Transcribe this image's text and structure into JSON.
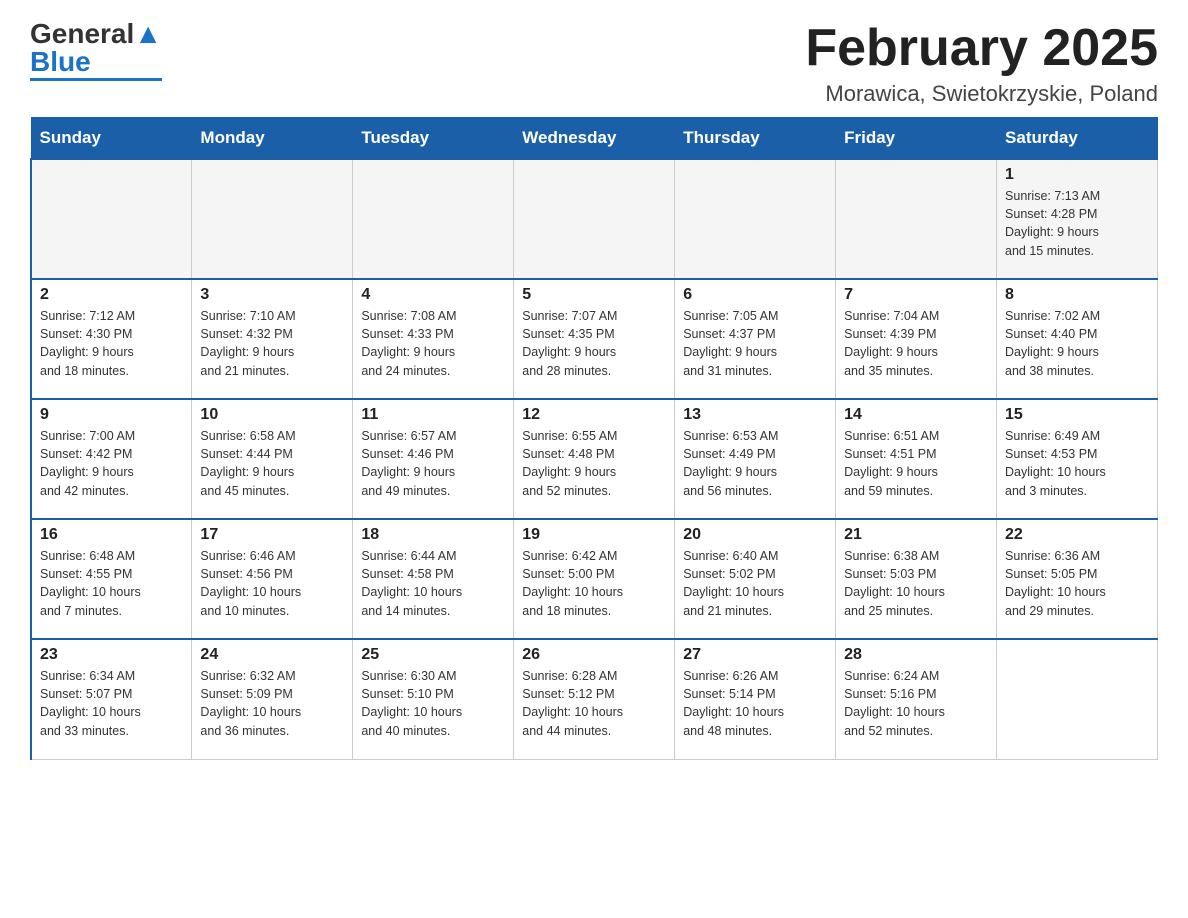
{
  "header": {
    "logo_main": "General",
    "logo_accent": "Blue",
    "title": "February 2025",
    "subtitle": "Morawica, Swietokrzyskie, Poland"
  },
  "weekdays": [
    "Sunday",
    "Monday",
    "Tuesday",
    "Wednesday",
    "Thursday",
    "Friday",
    "Saturday"
  ],
  "weeks": [
    [
      {
        "day": "",
        "info": ""
      },
      {
        "day": "",
        "info": ""
      },
      {
        "day": "",
        "info": ""
      },
      {
        "day": "",
        "info": ""
      },
      {
        "day": "",
        "info": ""
      },
      {
        "day": "",
        "info": ""
      },
      {
        "day": "1",
        "info": "Sunrise: 7:13 AM\nSunset: 4:28 PM\nDaylight: 9 hours\nand 15 minutes."
      }
    ],
    [
      {
        "day": "2",
        "info": "Sunrise: 7:12 AM\nSunset: 4:30 PM\nDaylight: 9 hours\nand 18 minutes."
      },
      {
        "day": "3",
        "info": "Sunrise: 7:10 AM\nSunset: 4:32 PM\nDaylight: 9 hours\nand 21 minutes."
      },
      {
        "day": "4",
        "info": "Sunrise: 7:08 AM\nSunset: 4:33 PM\nDaylight: 9 hours\nand 24 minutes."
      },
      {
        "day": "5",
        "info": "Sunrise: 7:07 AM\nSunset: 4:35 PM\nDaylight: 9 hours\nand 28 minutes."
      },
      {
        "day": "6",
        "info": "Sunrise: 7:05 AM\nSunset: 4:37 PM\nDaylight: 9 hours\nand 31 minutes."
      },
      {
        "day": "7",
        "info": "Sunrise: 7:04 AM\nSunset: 4:39 PM\nDaylight: 9 hours\nand 35 minutes."
      },
      {
        "day": "8",
        "info": "Sunrise: 7:02 AM\nSunset: 4:40 PM\nDaylight: 9 hours\nand 38 minutes."
      }
    ],
    [
      {
        "day": "9",
        "info": "Sunrise: 7:00 AM\nSunset: 4:42 PM\nDaylight: 9 hours\nand 42 minutes."
      },
      {
        "day": "10",
        "info": "Sunrise: 6:58 AM\nSunset: 4:44 PM\nDaylight: 9 hours\nand 45 minutes."
      },
      {
        "day": "11",
        "info": "Sunrise: 6:57 AM\nSunset: 4:46 PM\nDaylight: 9 hours\nand 49 minutes."
      },
      {
        "day": "12",
        "info": "Sunrise: 6:55 AM\nSunset: 4:48 PM\nDaylight: 9 hours\nand 52 minutes."
      },
      {
        "day": "13",
        "info": "Sunrise: 6:53 AM\nSunset: 4:49 PM\nDaylight: 9 hours\nand 56 minutes."
      },
      {
        "day": "14",
        "info": "Sunrise: 6:51 AM\nSunset: 4:51 PM\nDaylight: 9 hours\nand 59 minutes."
      },
      {
        "day": "15",
        "info": "Sunrise: 6:49 AM\nSunset: 4:53 PM\nDaylight: 10 hours\nand 3 minutes."
      }
    ],
    [
      {
        "day": "16",
        "info": "Sunrise: 6:48 AM\nSunset: 4:55 PM\nDaylight: 10 hours\nand 7 minutes."
      },
      {
        "day": "17",
        "info": "Sunrise: 6:46 AM\nSunset: 4:56 PM\nDaylight: 10 hours\nand 10 minutes."
      },
      {
        "day": "18",
        "info": "Sunrise: 6:44 AM\nSunset: 4:58 PM\nDaylight: 10 hours\nand 14 minutes."
      },
      {
        "day": "19",
        "info": "Sunrise: 6:42 AM\nSunset: 5:00 PM\nDaylight: 10 hours\nand 18 minutes."
      },
      {
        "day": "20",
        "info": "Sunrise: 6:40 AM\nSunset: 5:02 PM\nDaylight: 10 hours\nand 21 minutes."
      },
      {
        "day": "21",
        "info": "Sunrise: 6:38 AM\nSunset: 5:03 PM\nDaylight: 10 hours\nand 25 minutes."
      },
      {
        "day": "22",
        "info": "Sunrise: 6:36 AM\nSunset: 5:05 PM\nDaylight: 10 hours\nand 29 minutes."
      }
    ],
    [
      {
        "day": "23",
        "info": "Sunrise: 6:34 AM\nSunset: 5:07 PM\nDaylight: 10 hours\nand 33 minutes."
      },
      {
        "day": "24",
        "info": "Sunrise: 6:32 AM\nSunset: 5:09 PM\nDaylight: 10 hours\nand 36 minutes."
      },
      {
        "day": "25",
        "info": "Sunrise: 6:30 AM\nSunset: 5:10 PM\nDaylight: 10 hours\nand 40 minutes."
      },
      {
        "day": "26",
        "info": "Sunrise: 6:28 AM\nSunset: 5:12 PM\nDaylight: 10 hours\nand 44 minutes."
      },
      {
        "day": "27",
        "info": "Sunrise: 6:26 AM\nSunset: 5:14 PM\nDaylight: 10 hours\nand 48 minutes."
      },
      {
        "day": "28",
        "info": "Sunrise: 6:24 AM\nSunset: 5:16 PM\nDaylight: 10 hours\nand 52 minutes."
      },
      {
        "day": "",
        "info": ""
      }
    ]
  ]
}
